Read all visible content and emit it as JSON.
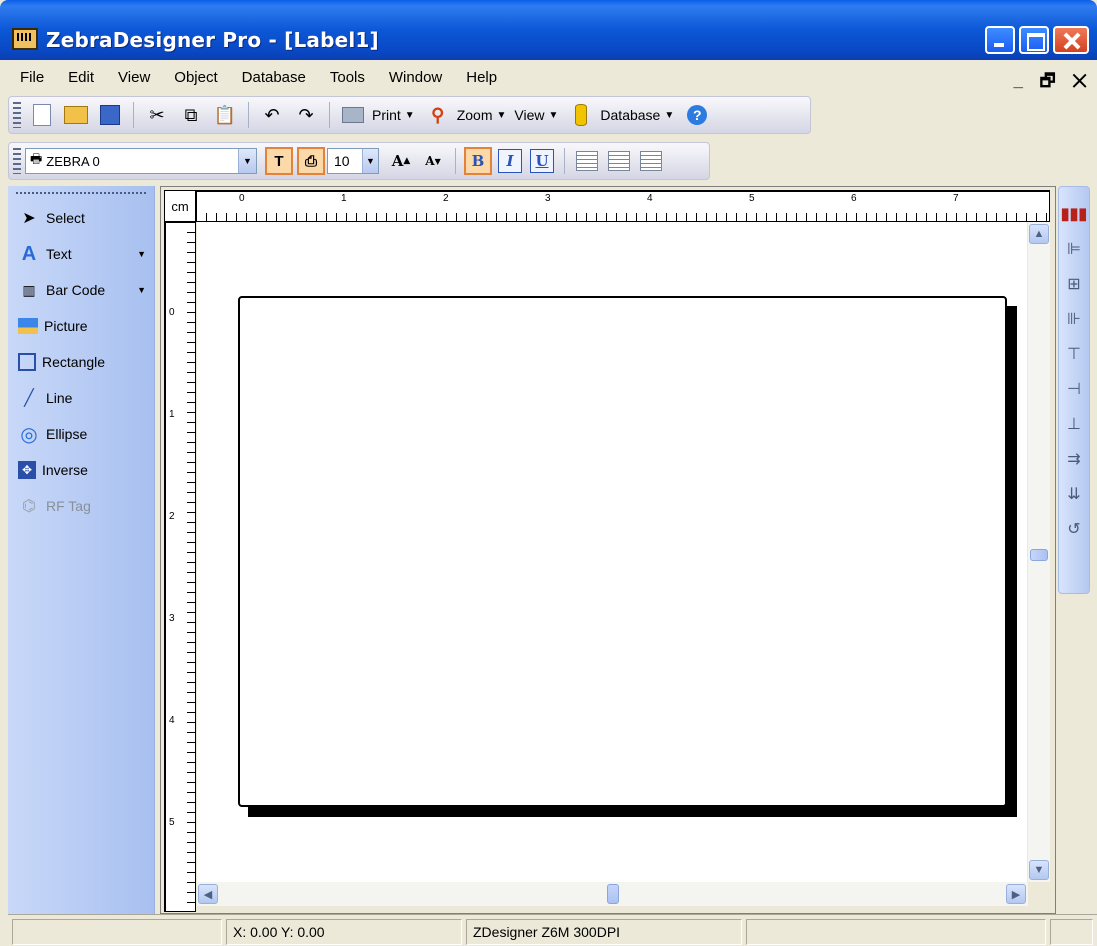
{
  "window": {
    "title": "ZebraDesigner Pro - [Label1]"
  },
  "menu": {
    "items": [
      "File",
      "Edit",
      "View",
      "Object",
      "Database",
      "Tools",
      "Window",
      "Help"
    ],
    "right": "_ 🗗 ✕"
  },
  "toolbar1": {
    "print_label": "Print",
    "zoom_label": "Zoom",
    "view_label": "View",
    "database_label": "Database"
  },
  "toolbar2": {
    "printer": "ZEBRA 0",
    "font_size": "10"
  },
  "toolbox": {
    "items": [
      {
        "label": "Select",
        "icon": "pointer-icon"
      },
      {
        "label": "Text",
        "icon": "text-icon"
      },
      {
        "label": "Bar Code",
        "icon": "barcode-icon"
      },
      {
        "label": "Picture",
        "icon": "picture-icon"
      },
      {
        "label": "Rectangle",
        "icon": "rectangle-icon"
      },
      {
        "label": "Line",
        "icon": "line-icon"
      },
      {
        "label": "Ellipse",
        "icon": "ellipse-icon"
      },
      {
        "label": "Inverse",
        "icon": "inverse-icon"
      },
      {
        "label": "RF Tag",
        "icon": "rf-tag-icon"
      }
    ]
  },
  "ruler": {
    "unit": "cm",
    "top_marks": [
      "0",
      "1",
      "2",
      "3",
      "4",
      "5",
      "6",
      "7"
    ],
    "left_marks": [
      "0",
      "1",
      "2",
      "3",
      "4",
      "5"
    ]
  },
  "statusbar": {
    "coords": "X:  0.00 Y:  0.00",
    "printer": "ZDesigner Z6M 300DPI"
  }
}
